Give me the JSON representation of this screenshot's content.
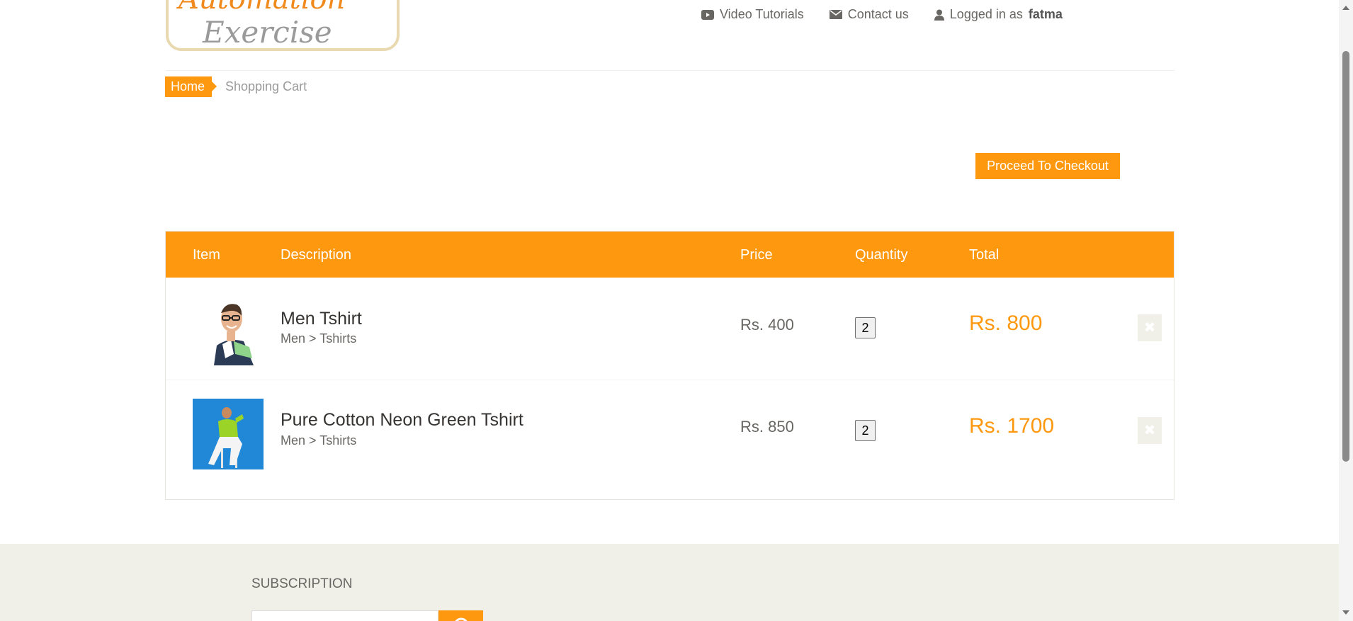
{
  "logo": {
    "line1": "Automation",
    "line2": "Exercise"
  },
  "nav": {
    "video": "Video Tutorials",
    "contact": "Contact us",
    "logged_prefix": "Logged in as",
    "username": "fatma"
  },
  "breadcrumb": {
    "home": "Home",
    "current": "Shopping Cart"
  },
  "checkout_label": "Proceed To Checkout",
  "table": {
    "headers": {
      "item": "Item",
      "description": "Description",
      "price": "Price",
      "quantity": "Quantity",
      "total": "Total"
    },
    "rows": [
      {
        "name": "Men Tshirt",
        "category": "Men > Tshirts",
        "price": "Rs. 400",
        "quantity": "2",
        "total": "Rs. 800"
      },
      {
        "name": "Pure Cotton Neon Green Tshirt",
        "category": "Men > Tshirts",
        "price": "Rs. 850",
        "quantity": "2",
        "total": "Rs. 1700"
      }
    ]
  },
  "footer": {
    "subscription": "SUBSCRIPTION"
  },
  "colors": {
    "accent": "#fe980f",
    "footer_bg": "#f0f0e9"
  },
  "icons": {
    "video": "youtube-play-icon",
    "contact": "envelope-icon",
    "user": "user-icon",
    "delete": "close-icon",
    "subscribe": "arrow-circle-icon"
  }
}
